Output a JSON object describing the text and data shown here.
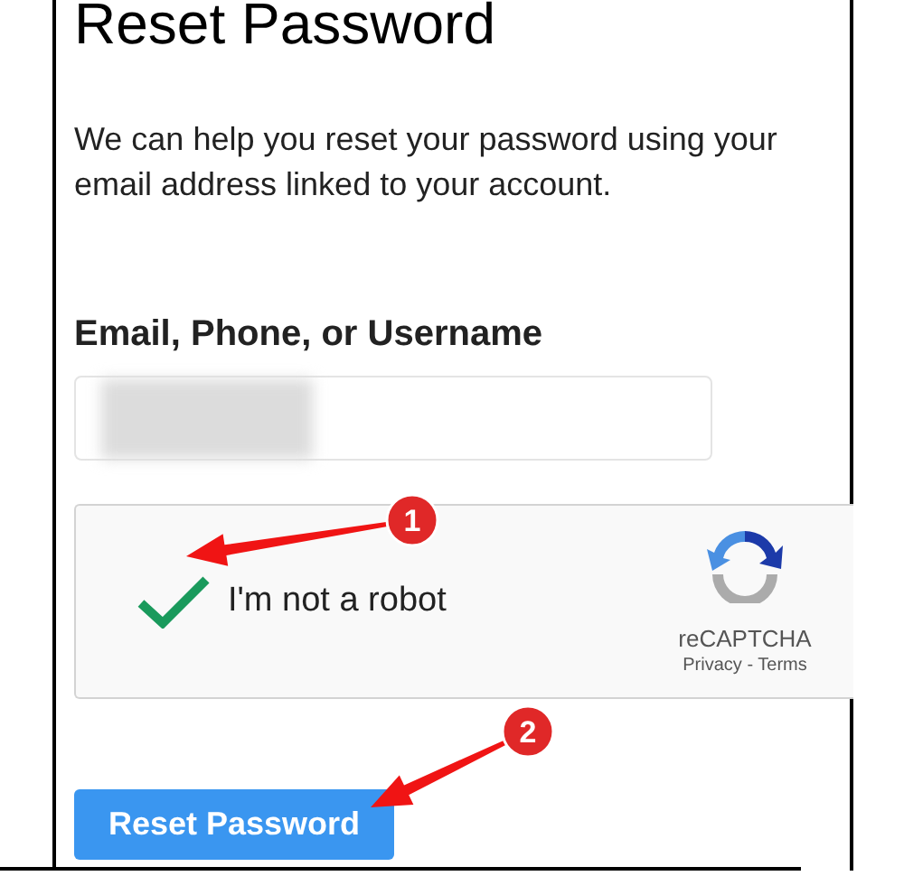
{
  "title": "Reset Password",
  "intro": "We can help you reset your password using your email address linked to your account.",
  "field": {
    "label": "Email, Phone, or Username",
    "value_redacted": true
  },
  "captcha": {
    "label": "I'm not a robot",
    "checked": true,
    "brand": "reCAPTCHA",
    "links": "Privacy - Terms"
  },
  "submit": {
    "label": "Reset Password"
  },
  "callouts": [
    {
      "number": "1"
    },
    {
      "number": "2"
    }
  ]
}
